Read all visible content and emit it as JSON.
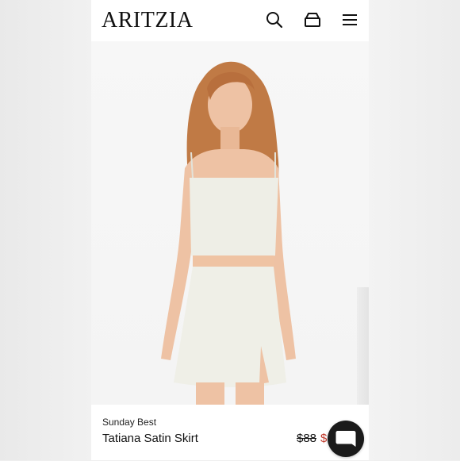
{
  "header": {
    "logo": "ARITZIA",
    "icons": [
      "search-icon",
      "bag-icon",
      "menu-icon"
    ]
  },
  "product": {
    "brand": "Sunday Best",
    "name": "Tatiana Satin Skirt",
    "original_price": "$88",
    "sale_price": "$"
  },
  "colors": {
    "logo": "#111111",
    "sale": "#c0392b",
    "chat_button": "#1b1b1b"
  }
}
